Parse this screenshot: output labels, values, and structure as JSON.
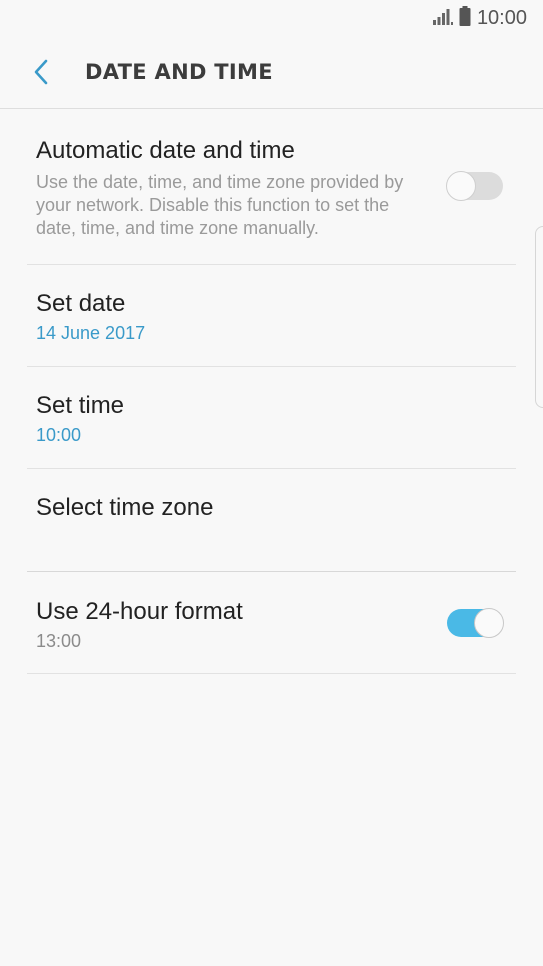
{
  "status_bar": {
    "time": "10:00",
    "signal_icon": "signal-icon",
    "battery_icon": "battery-icon"
  },
  "header": {
    "title": "DATE AND TIME",
    "back_icon": "chevron-left-icon"
  },
  "settings": {
    "automatic": {
      "title": "Automatic date and time",
      "description": "Use the date, time, and time zone provided by your network. Disable this function to set the date, time, and time zone manually.",
      "enabled": false
    },
    "set_date": {
      "title": "Set date",
      "value": "14 June 2017"
    },
    "set_time": {
      "title": "Set time",
      "value": "10:00"
    },
    "time_zone": {
      "title": "Select time zone"
    },
    "format_24h": {
      "title": "Use 24-hour format",
      "value": "13:00",
      "enabled": true
    }
  },
  "colors": {
    "accent": "#3a9ac9",
    "toggle_on": "#4ab9e6",
    "background": "#f8f8f8"
  }
}
